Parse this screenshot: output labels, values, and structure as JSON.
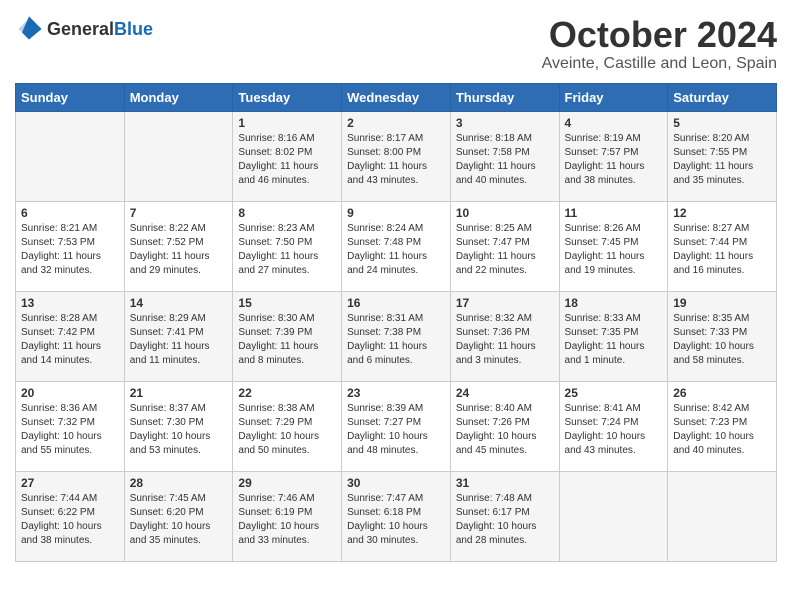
{
  "header": {
    "logo_general": "General",
    "logo_blue": "Blue",
    "month": "October 2024",
    "location": "Aveinte, Castille and Leon, Spain"
  },
  "days_of_week": [
    "Sunday",
    "Monday",
    "Tuesday",
    "Wednesday",
    "Thursday",
    "Friday",
    "Saturday"
  ],
  "weeks": [
    [
      {
        "day": "",
        "sunrise": "",
        "sunset": "",
        "daylight": ""
      },
      {
        "day": "",
        "sunrise": "",
        "sunset": "",
        "daylight": ""
      },
      {
        "day": "1",
        "sunrise": "Sunrise: 8:16 AM",
        "sunset": "Sunset: 8:02 PM",
        "daylight": "Daylight: 11 hours and 46 minutes."
      },
      {
        "day": "2",
        "sunrise": "Sunrise: 8:17 AM",
        "sunset": "Sunset: 8:00 PM",
        "daylight": "Daylight: 11 hours and 43 minutes."
      },
      {
        "day": "3",
        "sunrise": "Sunrise: 8:18 AM",
        "sunset": "Sunset: 7:58 PM",
        "daylight": "Daylight: 11 hours and 40 minutes."
      },
      {
        "day": "4",
        "sunrise": "Sunrise: 8:19 AM",
        "sunset": "Sunset: 7:57 PM",
        "daylight": "Daylight: 11 hours and 38 minutes."
      },
      {
        "day": "5",
        "sunrise": "Sunrise: 8:20 AM",
        "sunset": "Sunset: 7:55 PM",
        "daylight": "Daylight: 11 hours and 35 minutes."
      }
    ],
    [
      {
        "day": "6",
        "sunrise": "Sunrise: 8:21 AM",
        "sunset": "Sunset: 7:53 PM",
        "daylight": "Daylight: 11 hours and 32 minutes."
      },
      {
        "day": "7",
        "sunrise": "Sunrise: 8:22 AM",
        "sunset": "Sunset: 7:52 PM",
        "daylight": "Daylight: 11 hours and 29 minutes."
      },
      {
        "day": "8",
        "sunrise": "Sunrise: 8:23 AM",
        "sunset": "Sunset: 7:50 PM",
        "daylight": "Daylight: 11 hours and 27 minutes."
      },
      {
        "day": "9",
        "sunrise": "Sunrise: 8:24 AM",
        "sunset": "Sunset: 7:48 PM",
        "daylight": "Daylight: 11 hours and 24 minutes."
      },
      {
        "day": "10",
        "sunrise": "Sunrise: 8:25 AM",
        "sunset": "Sunset: 7:47 PM",
        "daylight": "Daylight: 11 hours and 22 minutes."
      },
      {
        "day": "11",
        "sunrise": "Sunrise: 8:26 AM",
        "sunset": "Sunset: 7:45 PM",
        "daylight": "Daylight: 11 hours and 19 minutes."
      },
      {
        "day": "12",
        "sunrise": "Sunrise: 8:27 AM",
        "sunset": "Sunset: 7:44 PM",
        "daylight": "Daylight: 11 hours and 16 minutes."
      }
    ],
    [
      {
        "day": "13",
        "sunrise": "Sunrise: 8:28 AM",
        "sunset": "Sunset: 7:42 PM",
        "daylight": "Daylight: 11 hours and 14 minutes."
      },
      {
        "day": "14",
        "sunrise": "Sunrise: 8:29 AM",
        "sunset": "Sunset: 7:41 PM",
        "daylight": "Daylight: 11 hours and 11 minutes."
      },
      {
        "day": "15",
        "sunrise": "Sunrise: 8:30 AM",
        "sunset": "Sunset: 7:39 PM",
        "daylight": "Daylight: 11 hours and 8 minutes."
      },
      {
        "day": "16",
        "sunrise": "Sunrise: 8:31 AM",
        "sunset": "Sunset: 7:38 PM",
        "daylight": "Daylight: 11 hours and 6 minutes."
      },
      {
        "day": "17",
        "sunrise": "Sunrise: 8:32 AM",
        "sunset": "Sunset: 7:36 PM",
        "daylight": "Daylight: 11 hours and 3 minutes."
      },
      {
        "day": "18",
        "sunrise": "Sunrise: 8:33 AM",
        "sunset": "Sunset: 7:35 PM",
        "daylight": "Daylight: 11 hours and 1 minute."
      },
      {
        "day": "19",
        "sunrise": "Sunrise: 8:35 AM",
        "sunset": "Sunset: 7:33 PM",
        "daylight": "Daylight: 10 hours and 58 minutes."
      }
    ],
    [
      {
        "day": "20",
        "sunrise": "Sunrise: 8:36 AM",
        "sunset": "Sunset: 7:32 PM",
        "daylight": "Daylight: 10 hours and 55 minutes."
      },
      {
        "day": "21",
        "sunrise": "Sunrise: 8:37 AM",
        "sunset": "Sunset: 7:30 PM",
        "daylight": "Daylight: 10 hours and 53 minutes."
      },
      {
        "day": "22",
        "sunrise": "Sunrise: 8:38 AM",
        "sunset": "Sunset: 7:29 PM",
        "daylight": "Daylight: 10 hours and 50 minutes."
      },
      {
        "day": "23",
        "sunrise": "Sunrise: 8:39 AM",
        "sunset": "Sunset: 7:27 PM",
        "daylight": "Daylight: 10 hours and 48 minutes."
      },
      {
        "day": "24",
        "sunrise": "Sunrise: 8:40 AM",
        "sunset": "Sunset: 7:26 PM",
        "daylight": "Daylight: 10 hours and 45 minutes."
      },
      {
        "day": "25",
        "sunrise": "Sunrise: 8:41 AM",
        "sunset": "Sunset: 7:24 PM",
        "daylight": "Daylight: 10 hours and 43 minutes."
      },
      {
        "day": "26",
        "sunrise": "Sunrise: 8:42 AM",
        "sunset": "Sunset: 7:23 PM",
        "daylight": "Daylight: 10 hours and 40 minutes."
      }
    ],
    [
      {
        "day": "27",
        "sunrise": "Sunrise: 7:44 AM",
        "sunset": "Sunset: 6:22 PM",
        "daylight": "Daylight: 10 hours and 38 minutes."
      },
      {
        "day": "28",
        "sunrise": "Sunrise: 7:45 AM",
        "sunset": "Sunset: 6:20 PM",
        "daylight": "Daylight: 10 hours and 35 minutes."
      },
      {
        "day": "29",
        "sunrise": "Sunrise: 7:46 AM",
        "sunset": "Sunset: 6:19 PM",
        "daylight": "Daylight: 10 hours and 33 minutes."
      },
      {
        "day": "30",
        "sunrise": "Sunrise: 7:47 AM",
        "sunset": "Sunset: 6:18 PM",
        "daylight": "Daylight: 10 hours and 30 minutes."
      },
      {
        "day": "31",
        "sunrise": "Sunrise: 7:48 AM",
        "sunset": "Sunset: 6:17 PM",
        "daylight": "Daylight: 10 hours and 28 minutes."
      },
      {
        "day": "",
        "sunrise": "",
        "sunset": "",
        "daylight": ""
      },
      {
        "day": "",
        "sunrise": "",
        "sunset": "",
        "daylight": ""
      }
    ]
  ]
}
